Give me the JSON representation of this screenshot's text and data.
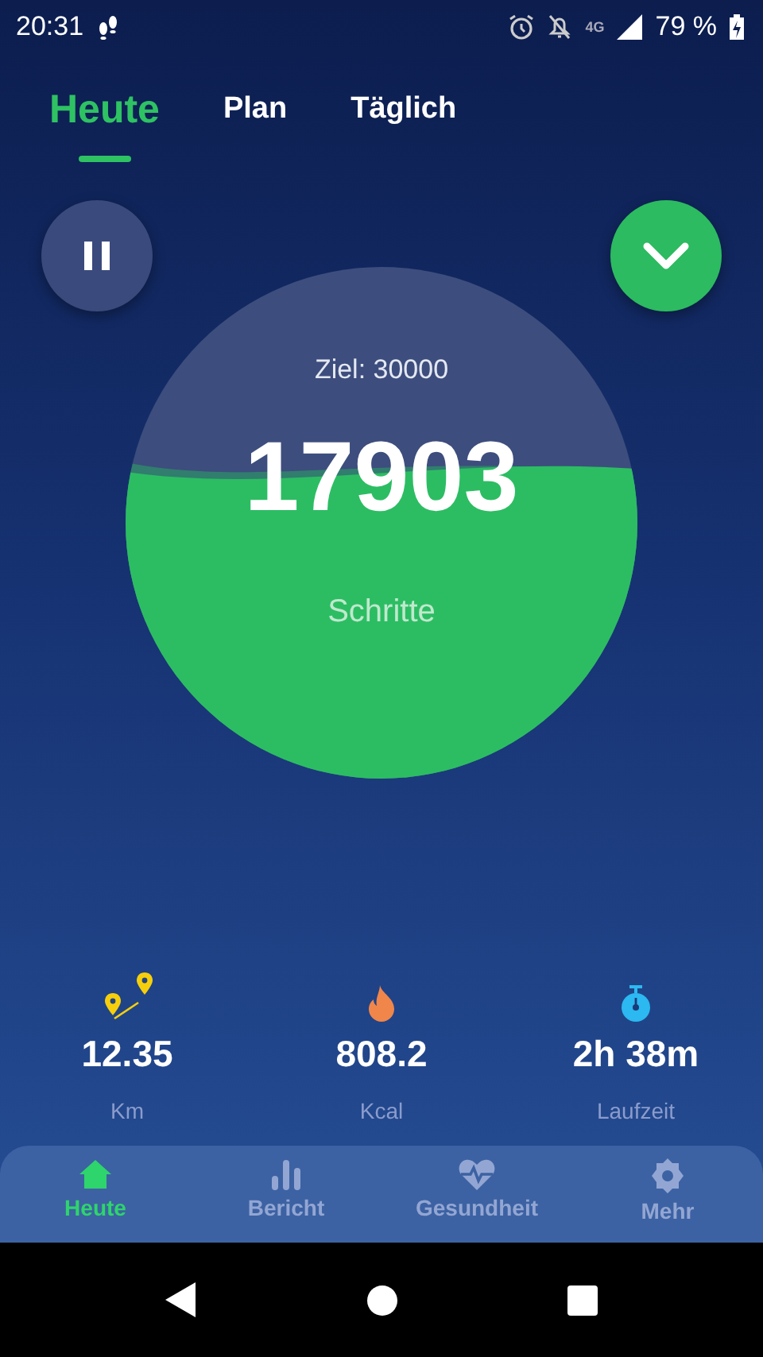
{
  "status_bar": {
    "time": "20:31",
    "network": "4G",
    "battery": "79 %"
  },
  "tabs": [
    {
      "label": "Heute",
      "selected": true
    },
    {
      "label": "Plan",
      "selected": false
    },
    {
      "label": "Täglich",
      "selected": false
    }
  ],
  "controls": {
    "paused": false
  },
  "progress": {
    "goal": "Ziel: 30000",
    "steps": "17903",
    "unit": "Schritte"
  },
  "stats": [
    {
      "kind": "distance",
      "value": "12.35",
      "label": "Km"
    },
    {
      "kind": "calories",
      "value": "808.2",
      "label": "Kcal"
    },
    {
      "kind": "time",
      "value": "2h 38m",
      "label": "Laufzeit"
    }
  ],
  "bottom_nav": [
    {
      "kind": "home",
      "label": "Heute",
      "selected": true
    },
    {
      "kind": "report",
      "label": "Bericht",
      "selected": false
    },
    {
      "kind": "health",
      "label": "Gesundheit",
      "selected": false
    },
    {
      "kind": "more",
      "label": "Mehr",
      "selected": false
    }
  ]
}
